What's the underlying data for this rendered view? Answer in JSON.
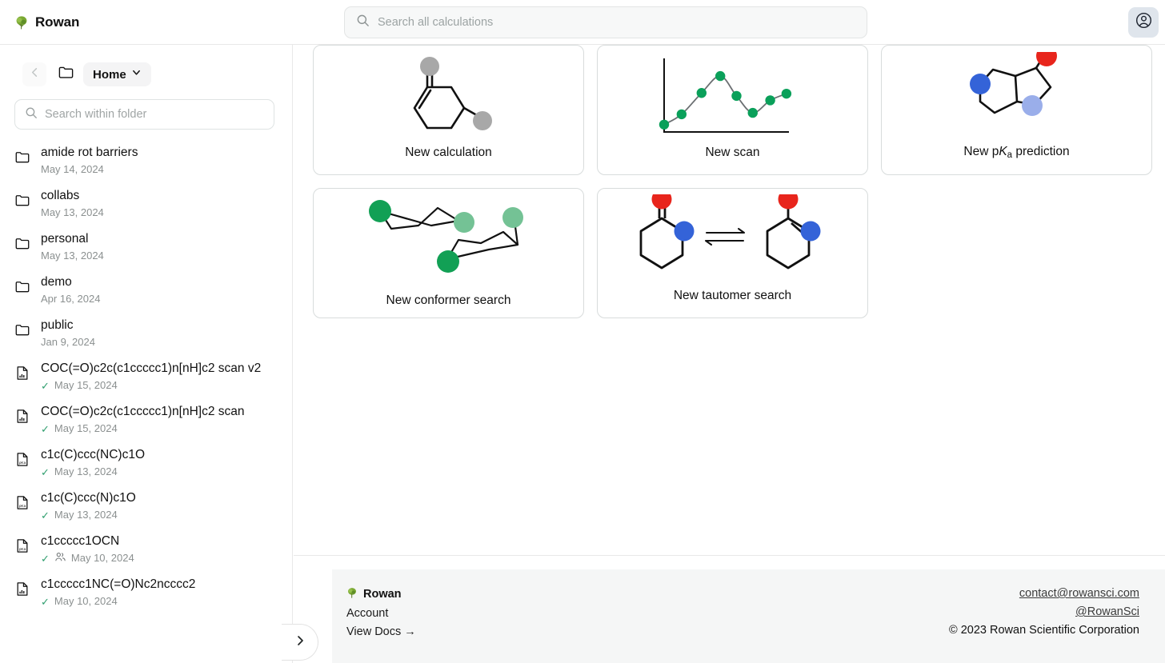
{
  "app": {
    "brand": "Rowan",
    "logo_icon": "tree-icon",
    "accent_green": "#6f9e2f",
    "check_green": "#2f9e6e"
  },
  "topbar": {
    "search_placeholder": "Search all calculations",
    "search_value": "",
    "search_icon": "search-icon",
    "account_icon": "user-circle-icon"
  },
  "sidebar": {
    "back_icon": "chevron-left-icon",
    "folder_icon": "folder-icon",
    "breadcrumb_label": "Home",
    "breadcrumb_chevron": "chevron-down-icon",
    "search_placeholder": "Search within folder",
    "search_value": "",
    "collapse_icon": "chevron-right-icon",
    "items": [
      {
        "name": "amide rot barriers",
        "date": "May 14, 2024",
        "icon": "folder-icon",
        "type": "folder",
        "done": false,
        "shared": false
      },
      {
        "name": "collabs",
        "date": "May 13, 2024",
        "icon": "folder-icon",
        "type": "folder",
        "done": false,
        "shared": false
      },
      {
        "name": "personal",
        "date": "May 13, 2024",
        "icon": "folder-icon",
        "type": "folder",
        "done": false,
        "shared": false
      },
      {
        "name": "demo",
        "date": "Apr 16, 2024",
        "icon": "folder-icon",
        "type": "folder",
        "done": false,
        "shared": false
      },
      {
        "name": "public",
        "date": "Jan 9, 2024",
        "icon": "folder-icon",
        "type": "folder",
        "done": false,
        "shared": false
      },
      {
        "name": "COC(=O)c2c(c1ccccc1)n[nH]c2 scan v2",
        "date": "May 15, 2024",
        "icon": "file-chart-icon",
        "type": "scan",
        "done": true,
        "shared": false
      },
      {
        "name": "COC(=O)c2c(c1ccccc1)n[nH]c2 scan",
        "date": "May 15, 2024",
        "icon": "file-chart-icon",
        "type": "scan",
        "done": true,
        "shared": false
      },
      {
        "name": "c1c(C)ccc(NC)c1O",
        "date": "May 13, 2024",
        "icon": "file-pka-icon",
        "type": "pka",
        "done": true,
        "shared": false
      },
      {
        "name": "c1c(C)ccc(N)c1O",
        "date": "May 13, 2024",
        "icon": "file-pka-icon",
        "type": "pka",
        "done": true,
        "shared": false
      },
      {
        "name": "c1ccccc1OCN",
        "date": "May 10, 2024",
        "icon": "file-pka-icon",
        "type": "pka",
        "done": true,
        "shared": true
      },
      {
        "name": "c1ccccc1NC(=O)Nc2ncccc2",
        "date": "May 10, 2024",
        "icon": "file-chart-icon",
        "type": "scan",
        "done": true,
        "shared": false
      }
    ],
    "check_symbol": "✓",
    "shared_icon": "people-icon"
  },
  "main": {
    "cards": [
      {
        "id": "new-calculation",
        "label": "New calculation",
        "art": "molecule-cyclohexenone"
      },
      {
        "id": "new-scan",
        "label": "New scan",
        "art": "line-chart"
      },
      {
        "id": "new-pka-prediction",
        "label_pre": "New p",
        "label_italic": "K",
        "label_sub": "a",
        "label_post": " prediction",
        "label": "New pKa prediction",
        "art": "molecule-bicyclic"
      },
      {
        "id": "new-conformer-search",
        "label": "New conformer search",
        "art": "molecule-chairs"
      },
      {
        "id": "new-tautomer-search",
        "label": "New tautomer search",
        "art": "molecule-tautomers"
      }
    ],
    "scan_chart": {
      "type": "line",
      "points": [
        {
          "x": 0,
          "y": 10
        },
        {
          "x": 14,
          "y": 24
        },
        {
          "x": 30,
          "y": 53
        },
        {
          "x": 45,
          "y": 76
        },
        {
          "x": 58,
          "y": 49
        },
        {
          "x": 71,
          "y": 26
        },
        {
          "x": 85,
          "y": 43
        },
        {
          "x": 98,
          "y": 52
        }
      ],
      "marker_color": "#0aa05a",
      "line_color": "#6b6f72",
      "axis_color": "#111111",
      "grid": false,
      "legend": false
    },
    "atom_colors": {
      "gray": "#a8a8a8",
      "red": "#e8251c",
      "blue": "#3463d8",
      "light_blue": "#9aaeea",
      "green_dark": "#12a055",
      "green_light": "#74c295"
    }
  },
  "footer": {
    "brand": "Rowan",
    "account_label": "Account",
    "docs_label": "View Docs →",
    "email": "contact@rowansci.com",
    "social": "@RowanSci",
    "copyright": "© 2023 Rowan Scientific Corporation"
  }
}
